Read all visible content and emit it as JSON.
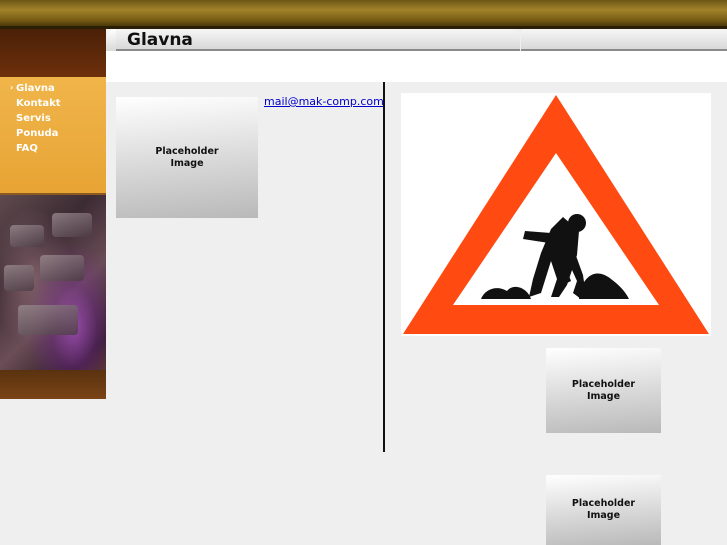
{
  "header": {
    "title": "Glavna"
  },
  "nav": {
    "items": [
      {
        "label": "Glavna",
        "active": true
      },
      {
        "label": "Kontakt",
        "active": false
      },
      {
        "label": "Servis",
        "active": false
      },
      {
        "label": "Ponuda",
        "active": false
      },
      {
        "label": "FAQ",
        "active": false
      }
    ],
    "active_marker": "›"
  },
  "content": {
    "email": "mail@mak-comp.com",
    "placeholder_text": "Placeholder\nImage"
  },
  "colors": {
    "sign_red": "#ff4a12",
    "nav_bg": "#eba93a",
    "header_gold": "#a1822a"
  },
  "icons": {
    "construction_sign": "men-at-work-sign-icon"
  }
}
